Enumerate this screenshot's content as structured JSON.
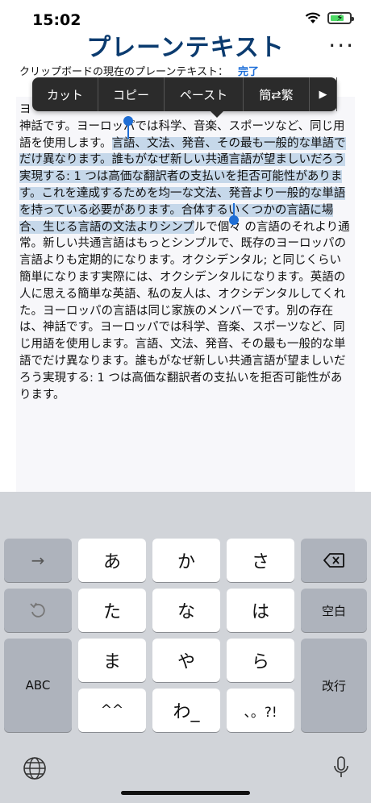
{
  "status": {
    "time": "15:02"
  },
  "header": {
    "title": "プレーンテキスト",
    "more_label": "···"
  },
  "status_line": {
    "label": "クリップボードの現在のプレーンテキスト：",
    "done": "完了"
  },
  "context_menu": {
    "items": [
      "カット",
      "コピー",
      "ペースト",
      "簡⇄繁"
    ],
    "more_arrow": "▶"
  },
  "text": {
    "line1": "ヨ",
    "before": "神話です。ヨーロッパでは科学、音楽、スポーツなど、同じ用語を使用します。",
    "selected": "言語、文法、発音、その最も一般的な単語でだけ異なります。誰もがなぜ新しい共通言語が望ましいだろう実現する: 1 つは高価な翻訳者の支払いを拒否可能性があります。これを達成するためを均一な文法、発音より一般的な単語を持っている必要があります。合体するいくつかの言語に場合、生じる言語の文法よりシンプ",
    "after": "ルで個々 の言語のそれより通常。新しい共通言語はもっとシンプルで、既存のヨーロッパの言語よりも定期的になります。オクシデンタル; と同じくらい簡単になります実際には、オクシデンタルになります。英語の人に思える簡単な英語、私の友人は、オクシデンタルしてくれた。ヨーロッパの言語は同じ家族のメンバーです。別の存在は、神話です。ヨーロッパでは科学、音楽、スポーツなど、同じ用語を使用します。言語、文法、発音、その最も一般的な単語でだけ異なります。誰もがなぜ新しい共通言語が望ましいだろう実現する: 1 つは高価な翻訳者の支払いを拒否可能性があります。"
  },
  "keyboard": {
    "keys": {
      "a": "あ",
      "ka": "か",
      "sa": "さ",
      "ta": "た",
      "na": "な",
      "ha": "は",
      "ma": "ま",
      "ya": "や",
      "ra": "ら",
      "dakuten": "^^",
      "wa": "わ_",
      "punct": "、。?!",
      "abc": "ABC",
      "space": "空白",
      "return": "改行",
      "arrow": "→"
    }
  },
  "colors": {
    "accent": "#1f6ed4",
    "title": "#0b3b6f",
    "selection": "#c6d8ea"
  }
}
